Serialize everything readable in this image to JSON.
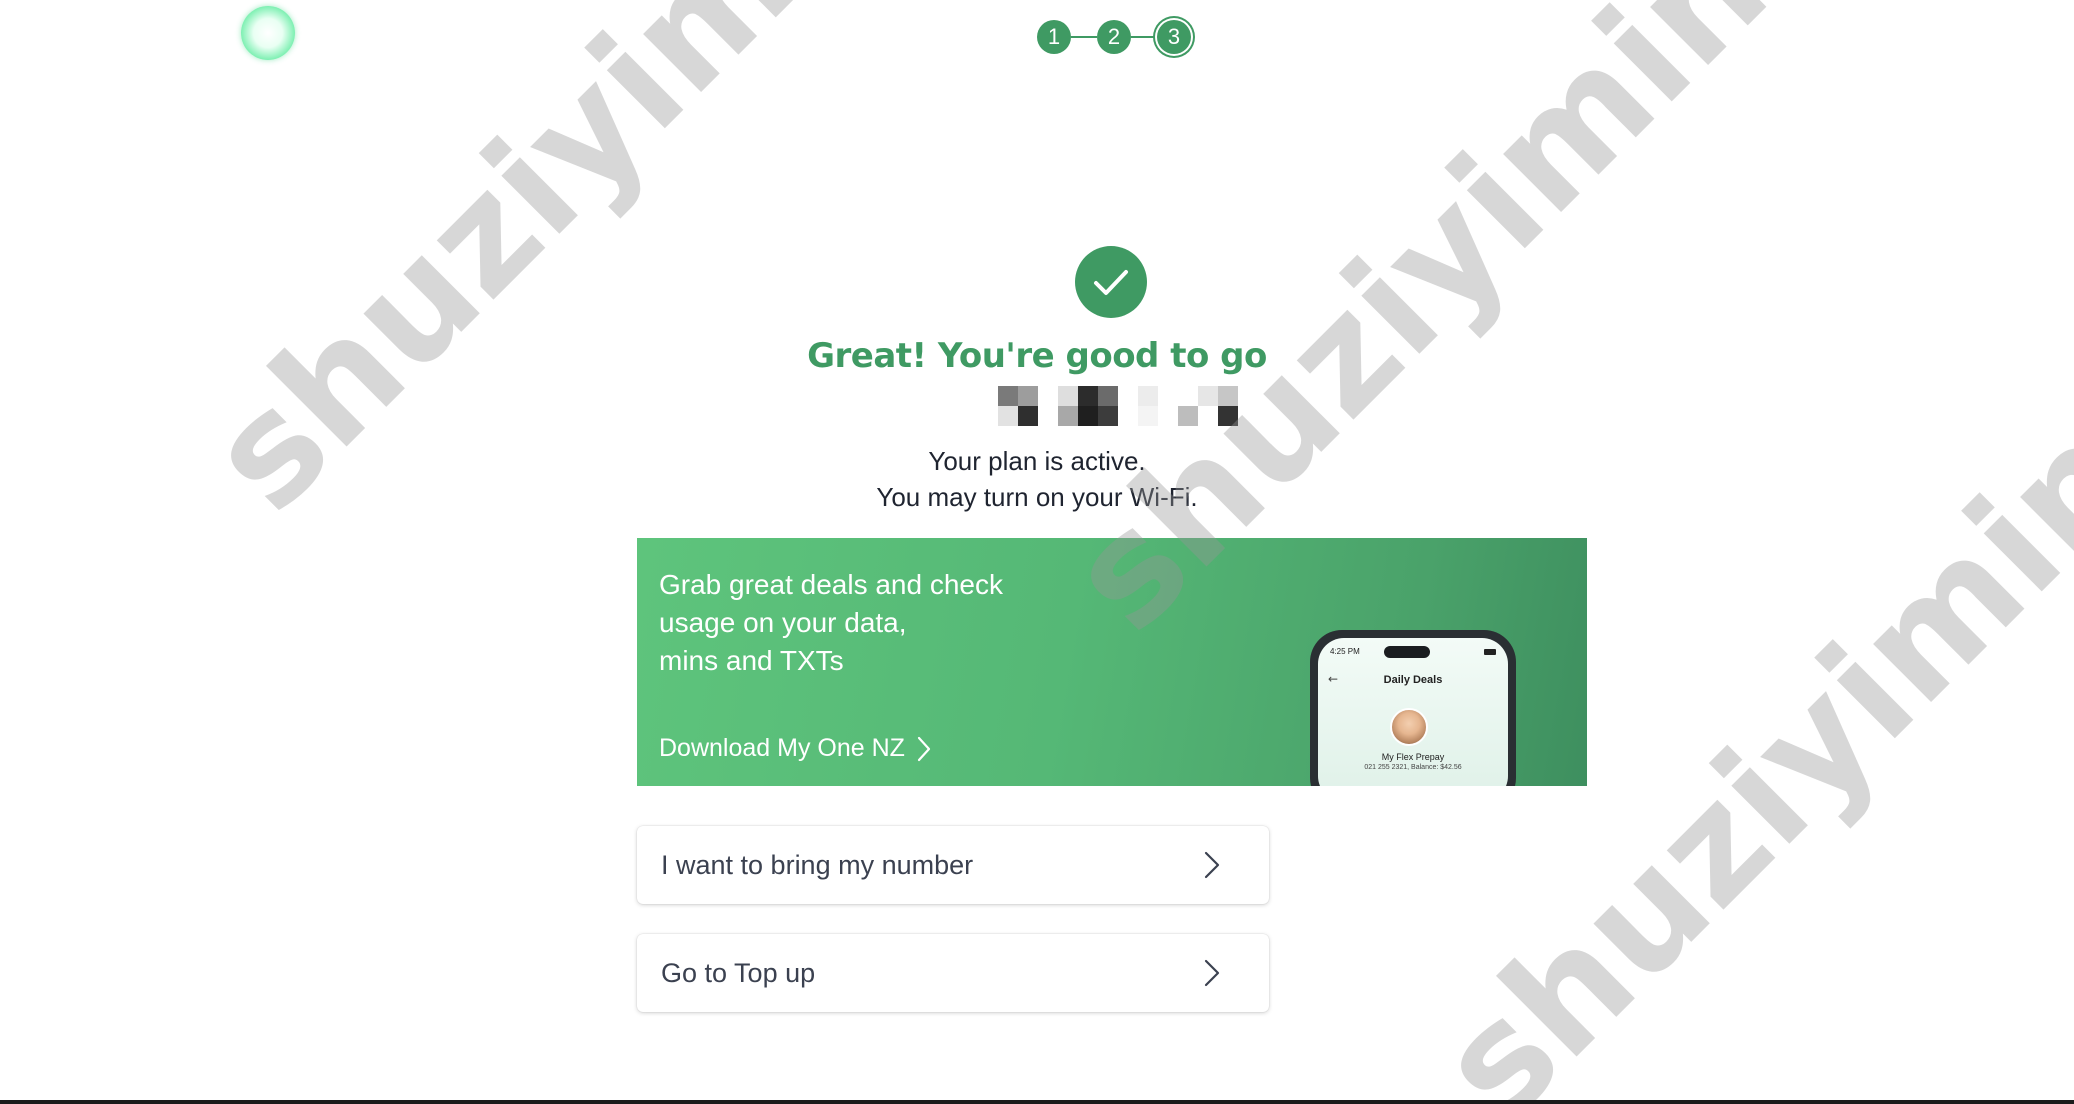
{
  "stepper": {
    "steps": [
      "1",
      "2",
      "3"
    ],
    "current": 3,
    "color": "#3f9a63"
  },
  "status": {
    "icon": "checkmark-icon",
    "headline": "Great! You're good to go",
    "line1": "Your plan is active.",
    "line2": "You may turn on your Wi-Fi."
  },
  "promo": {
    "lines": [
      "Grab great deals and check",
      "usage on your data,",
      "mins and TXTs"
    ],
    "link_label": "Download My One NZ",
    "phone": {
      "time": "4:25 PM",
      "title": "Daily Deals",
      "name": "My Flex Prepay",
      "detail": "021 255 2321, Balance: $42.56"
    }
  },
  "actions": [
    {
      "label": "I want to bring my number",
      "icon": "chevron-right-icon"
    },
    {
      "label": "Go to Top up",
      "icon": "chevron-right-icon"
    }
  ],
  "watermark": {
    "text": "shuziyimin.org"
  },
  "colors": {
    "brand_green": "#3f9a63",
    "promo_green": "#55b876",
    "text": "#1f2430"
  }
}
